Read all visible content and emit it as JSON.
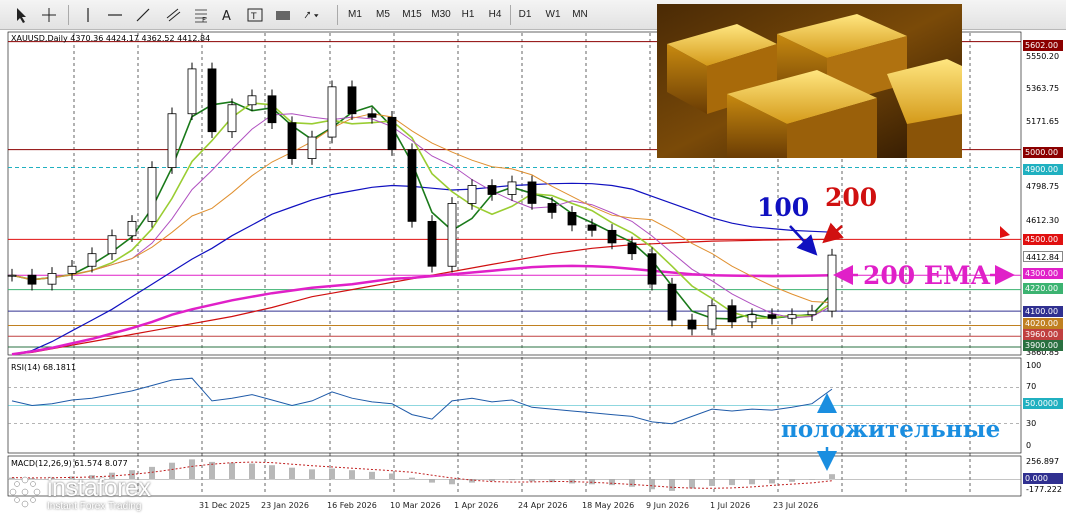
{
  "toolbar": {
    "timeframes": [
      "M1",
      "M5",
      "M15",
      "M30",
      "H1",
      "H4",
      "D1",
      "W1",
      "MN"
    ]
  },
  "header": {
    "symbol_line": "XAUUSD,Daily  4370.36 4424.17 4362.52 4412.84",
    "rsi_label": "RSI(14) 68.1811",
    "macd_label": "MACD(12,26,9) 61.574 8.077"
  },
  "annotations": {
    "ma100": "100",
    "ma200": "200",
    "ema200": "200 EMA",
    "positive": "положительные"
  },
  "logo": {
    "word": "instaforex",
    "tagline": "Instant Forex Trading"
  },
  "price_axis": [
    "5550.20",
    "5363.75",
    "5171.65",
    "4798.75",
    "4612.30",
    "3860.85"
  ],
  "price_tags": [
    {
      "label": "5602.00",
      "color": "#8b0000"
    },
    {
      "label": "5000.00",
      "color": "#8b0000"
    },
    {
      "label": "4900.00",
      "color": "#20b0c0"
    },
    {
      "label": "4500.00",
      "color": "#e01010"
    },
    {
      "label": "4412.84",
      "color": "#ffffff"
    },
    {
      "label": "4300.00",
      "color": "#e020c8"
    },
    {
      "label": "4220.00",
      "color": "#3cb371"
    },
    {
      "label": "4100.00",
      "color": "#303090"
    },
    {
      "label": "4020.00",
      "color": "#c08020"
    },
    {
      "label": "3960.00",
      "color": "#c04040"
    },
    {
      "label": "3900.00",
      "color": "#2a7040"
    }
  ],
  "rsi_axis": [
    "100",
    "70",
    "50.0000",
    "30",
    "0"
  ],
  "macd_axis": [
    "256.897",
    "0.000",
    "-177.222"
  ],
  "chart_data": {
    "type": "line",
    "symbol": "XAUUSD",
    "timeframe": "Daily",
    "ohlc_last": {
      "open": 4370.36,
      "high": 4424.17,
      "low": 4362.52,
      "close": 4412.84
    },
    "x_labels": [
      "31 Dec 2025",
      "23 Jan 2026",
      "16 Feb 2026",
      "10 Mar 2026",
      "1 Apr 2026",
      "24 Apr 2026",
      "18 May 2026",
      "9 Jun 2026",
      "1 Jul 2026",
      "23 Jul 2026"
    ],
    "ylim": [
      3860.85,
      5650
    ],
    "horizontal_levels": [
      5602,
      5000,
      4900,
      4500,
      4300,
      4220,
      4100,
      4020,
      3960,
      3900
    ],
    "series": [
      {
        "name": "price",
        "color": "#000000",
        "values": [
          4300,
          4250,
          4310,
          4350,
          4420,
          4520,
          4600,
          4900,
          5200,
          5450,
          5100,
          5250,
          5300,
          5150,
          4950,
          5070,
          5350,
          5200,
          5180,
          5000,
          4600,
          4350,
          4700,
          4800,
          4750,
          4820,
          4700,
          4650,
          4580,
          4550,
          4480,
          4420,
          4250,
          4050,
          4000,
          4130,
          4040,
          4080,
          4060,
          4080,
          4100,
          4412
        ]
      },
      {
        "name": "100",
        "color": "#1010c0",
        "values": [
          3860,
          3880,
          3930,
          3990,
          4050,
          4110,
          4180,
          4250,
          4320,
          4390,
          4450,
          4520,
          4580,
          4640,
          4680,
          4720,
          4750,
          4770,
          4790,
          4800,
          4795,
          4785,
          4775,
          4780,
          4790,
          4800,
          4805,
          4810,
          4812,
          4810,
          4800,
          4780,
          4740,
          4700,
          4660,
          4620,
          4590,
          4570,
          4560,
          4550,
          4545,
          4540
        ]
      },
      {
        "name": "200",
        "color": "#d01010",
        "values": [
          3860,
          3870,
          3890,
          3910,
          3930,
          3950,
          3970,
          3990,
          4010,
          4030,
          4050,
          4070,
          4095,
          4120,
          4150,
          4180,
          4200,
          4220,
          4240,
          4260,
          4280,
          4300,
          4320,
          4340,
          4360,
          4380,
          4400,
          4420,
          4435,
          4450,
          4460,
          4470,
          4475,
          4480,
          4485,
          4490,
          4492,
          4494,
          4496,
          4498,
          4499,
          4500
        ]
      },
      {
        "name": "200 EMA",
        "color": "#e020c8",
        "values": [
          3860,
          3875,
          3895,
          3920,
          3945,
          3975,
          4005,
          4040,
          4080,
          4110,
          4135,
          4160,
          4180,
          4200,
          4215,
          4230,
          4240,
          4250,
          4265,
          4280,
          4285,
          4295,
          4305,
          4315,
          4325,
          4335,
          4345,
          4350,
          4352,
          4350,
          4345,
          4335,
          4325,
          4315,
          4305,
          4300,
          4298,
          4296,
          4295,
          4296,
          4298,
          4300
        ]
      }
    ],
    "rsi": {
      "name": "RSI(14)",
      "last": 68.1811,
      "levels": [
        70,
        50,
        30
      ],
      "ylim": [
        0,
        100
      ],
      "values": [
        55,
        50,
        52,
        56,
        58,
        62,
        66,
        72,
        78,
        80,
        55,
        58,
        62,
        56,
        50,
        55,
        65,
        58,
        54,
        52,
        40,
        35,
        55,
        58,
        54,
        56,
        48,
        46,
        44,
        42,
        40,
        38,
        32,
        30,
        38,
        46,
        44,
        46,
        45,
        48,
        52,
        68
      ]
    },
    "macd": {
      "name": "MACD(12,26,9)",
      "main": 61.574,
      "signal": 8.077,
      "ylim": [
        -177.222,
        256.897
      ],
      "histogram": [
        20,
        15,
        20,
        35,
        50,
        80,
        110,
        150,
        200,
        240,
        210,
        200,
        190,
        170,
        140,
        120,
        130,
        110,
        90,
        70,
        20,
        -40,
        -60,
        -40,
        -20,
        -10,
        -25,
        -35,
        -50,
        -60,
        -70,
        -90,
        -120,
        -140,
        -110,
        -80,
        -70,
        -60,
        -50,
        -30,
        -5,
        62
      ]
    }
  }
}
